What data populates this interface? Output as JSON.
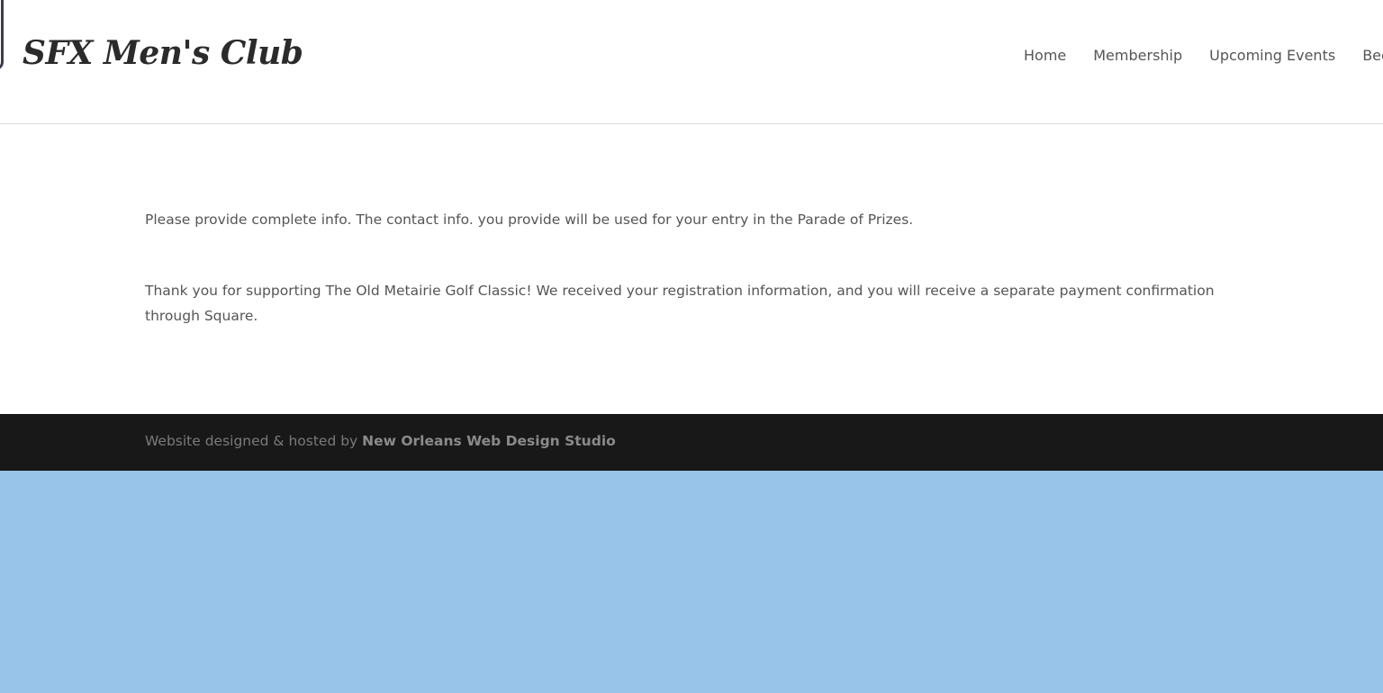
{
  "header": {
    "site_title": "SFX Men's Club",
    "nav": [
      {
        "label": "Home"
      },
      {
        "label": "Membership"
      },
      {
        "label": "Upcoming Events"
      },
      {
        "label": "Bec"
      }
    ]
  },
  "main": {
    "paragraph_1": "Please provide complete info. The contact info. you provide will be used for your entry in the Parade of Prizes.",
    "paragraph_2": "Thank you for supporting The Old Metairie Golf Classic! We received your registration information, and you will receive a separate payment confirmation through Square."
  },
  "footer": {
    "prefix": "Website designed & hosted by ",
    "link_label": "New Orleans Web Design Studio"
  },
  "colors": {
    "page_background": "#99c4e9",
    "footer_background": "#181818",
    "text": "#555555"
  }
}
